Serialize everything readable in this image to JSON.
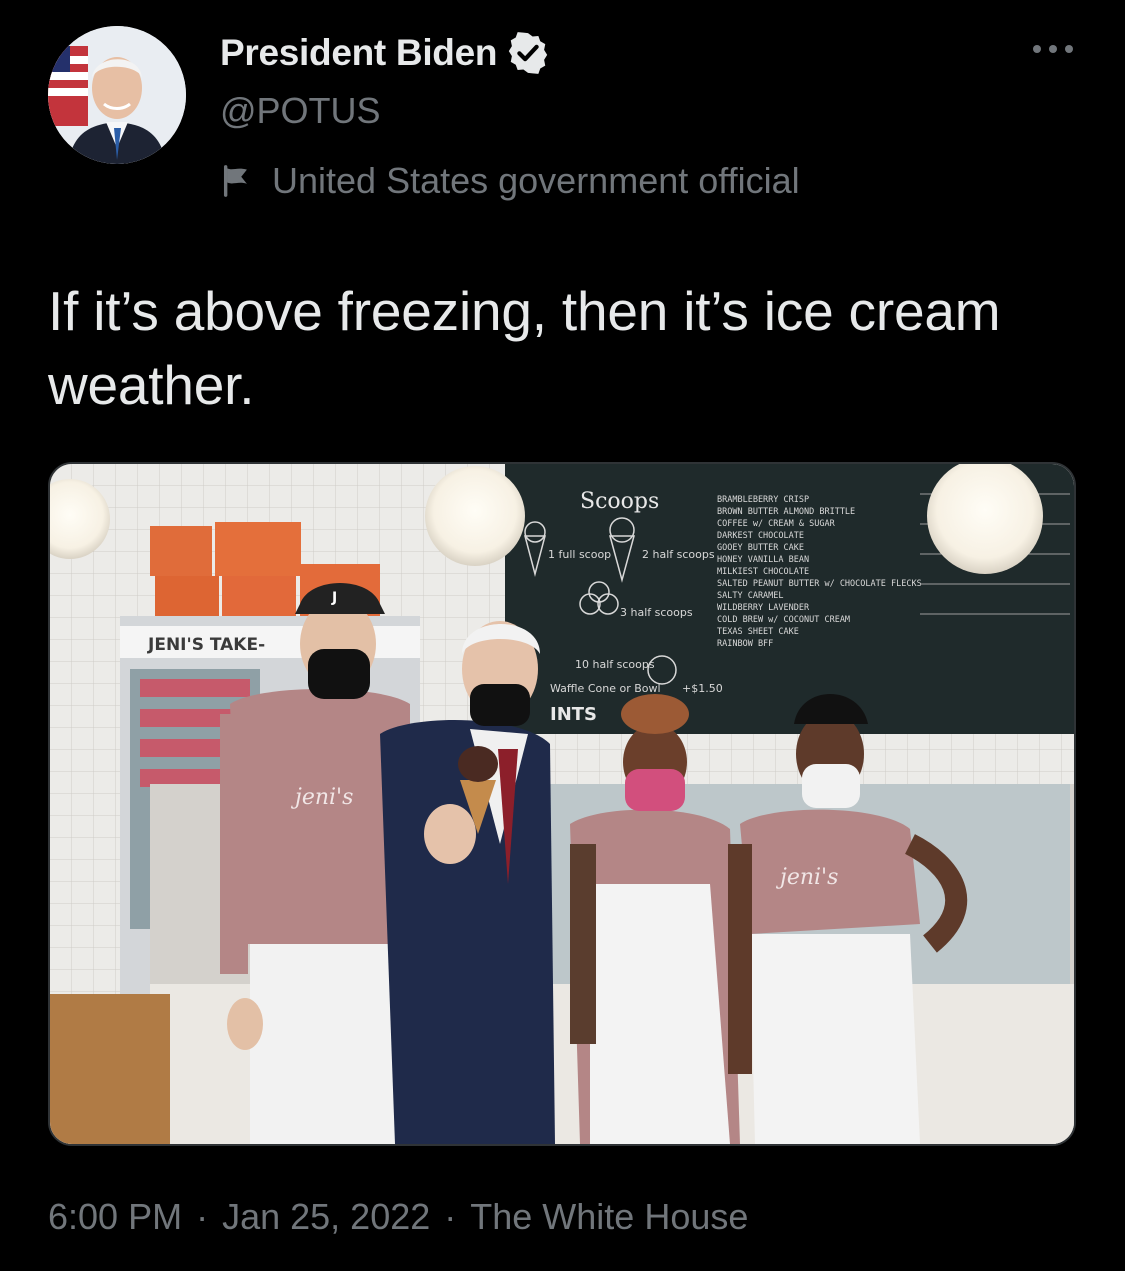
{
  "author": {
    "name": "President Biden",
    "handle": "@POTUS",
    "verified_icon": "verified-badge-icon",
    "label": "United States government official",
    "label_icon": "flag-icon"
  },
  "tweet": {
    "text": "If it’s above freezing, then it’s ice cream weather."
  },
  "photo": {
    "menu_title": "Scoops",
    "menu_items": [
      "1 full scoop",
      "2 half scoops",
      "3 half scoops",
      "10 half scoops",
      "Waffle Cone or Bowl",
      "+$1.50"
    ],
    "flavors": [
      "BRAMBLEBERRY CRISP",
      "BROWN BUTTER ALMOND BRITTLE",
      "COFFEE w/ CREAM & SUGAR",
      "DARKEST CHOCOLATE",
      "GOOEY BUTTER CAKE",
      "HONEY VANILLA BEAN",
      "MILKIEST CHOCOLATE",
      "SALTED PEANUT BUTTER w/ CHOCOLATE FLECKS",
      "SALTY CARAMEL",
      "WILDBERRY LAVENDER",
      "COLD BREW w/ COCONUT CREAM",
      "TEXAS SHEET CAKE",
      "RAINBOW BFF"
    ],
    "sign": "JENI'S TAKE-",
    "pints_label": "INTS",
    "shirt_text": "jeni's",
    "cap_letter": "J",
    "colors": {
      "board": "#1f2a2b",
      "shirt": "#b48686",
      "tile": "#ecebe8"
    }
  },
  "meta": {
    "time": "6:00 PM",
    "separator": "·",
    "date": "Jan 25, 2022",
    "source": "The White House"
  }
}
